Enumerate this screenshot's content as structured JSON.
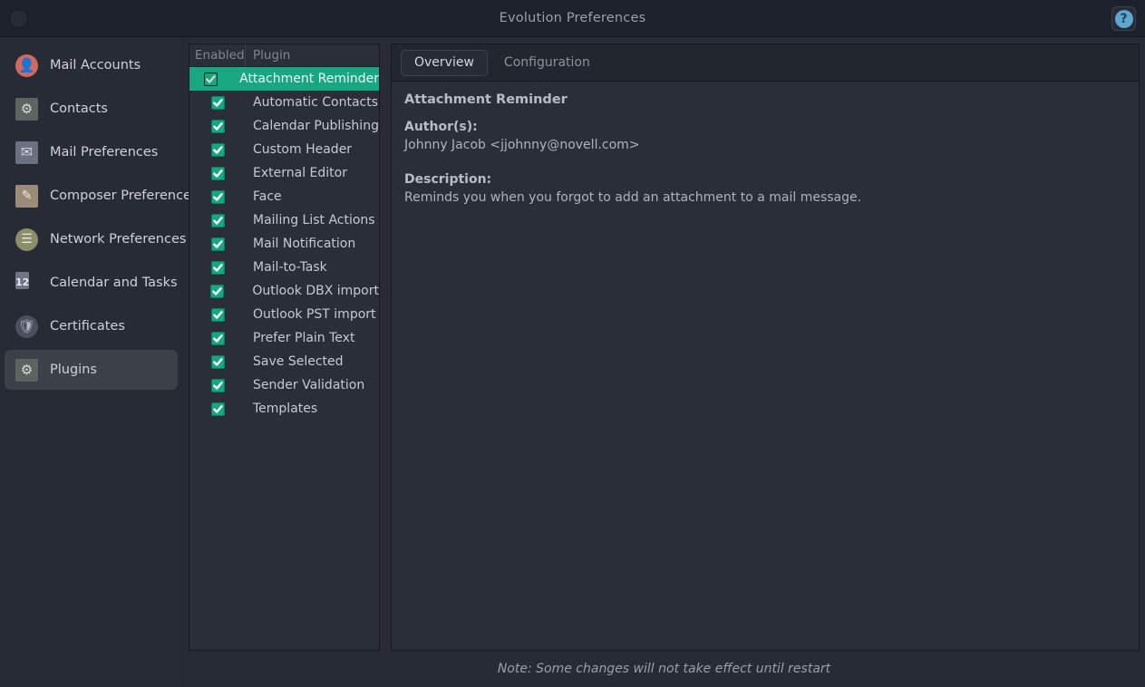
{
  "window": {
    "title": "Evolution Preferences",
    "close_icon": "window-circle-icon",
    "help_icon": "help-question-icon",
    "help_glyph": "?"
  },
  "sidebar": {
    "items": [
      {
        "label": "Mail Accounts",
        "icon": "mail-accounts-icon",
        "selected": false
      },
      {
        "label": "Contacts",
        "icon": "contacts-gear-icon",
        "selected": false
      },
      {
        "label": "Mail Preferences",
        "icon": "mail-preferences-envelope-icon",
        "selected": false
      },
      {
        "label": "Composer Preferences",
        "icon": "composer-pencil-icon",
        "selected": false
      },
      {
        "label": "Network Preferences",
        "icon": "network-server-icon",
        "selected": false
      },
      {
        "label": "Calendar and Tasks",
        "icon": "calendar-icon",
        "selected": false
      },
      {
        "label": "Certificates",
        "icon": "certificates-shield-icon",
        "selected": false
      },
      {
        "label": "Plugins",
        "icon": "plugins-gear-icon",
        "selected": true
      }
    ],
    "calendar_day": "12"
  },
  "plugin_list": {
    "columns": [
      "Enabled",
      "Plugin"
    ],
    "rows": [
      {
        "name": "Attachment Reminder",
        "enabled": true,
        "selected": true
      },
      {
        "name": "Automatic Contacts",
        "enabled": true,
        "selected": false
      },
      {
        "name": "Calendar Publishing",
        "enabled": true,
        "selected": false
      },
      {
        "name": "Custom Header",
        "enabled": true,
        "selected": false
      },
      {
        "name": "External Editor",
        "enabled": true,
        "selected": false
      },
      {
        "name": "Face",
        "enabled": true,
        "selected": false
      },
      {
        "name": "Mailing List Actions",
        "enabled": true,
        "selected": false
      },
      {
        "name": "Mail Notification",
        "enabled": true,
        "selected": false
      },
      {
        "name": "Mail-to-Task",
        "enabled": true,
        "selected": false
      },
      {
        "name": "Outlook DBX import",
        "enabled": true,
        "selected": false
      },
      {
        "name": "Outlook PST import",
        "enabled": true,
        "selected": false
      },
      {
        "name": "Prefer Plain Text",
        "enabled": true,
        "selected": false
      },
      {
        "name": "Save Selected",
        "enabled": true,
        "selected": false
      },
      {
        "name": "Sender Validation",
        "enabled": true,
        "selected": false
      },
      {
        "name": "Templates",
        "enabled": true,
        "selected": false
      }
    ]
  },
  "detail": {
    "tabs": [
      {
        "label": "Overview",
        "active": true
      },
      {
        "label": "Configuration",
        "active": false
      }
    ],
    "plugin_title": "Attachment Reminder",
    "authors_label": "Author(s):",
    "authors_value": "Johnny Jacob <jjohnny@novell.com>",
    "description_label": "Description:",
    "description_value": "Reminds you when you forgot to add an attachment to a mail message."
  },
  "footer": {
    "note": "Note: Some changes will not take effect until restart"
  },
  "colors": {
    "accent_teal": "#17a781",
    "window_bg": "#272b35",
    "titlebar_bg": "#1d212b",
    "panel_bg": "#2a2e39",
    "help_blue": "#5da7cf"
  }
}
